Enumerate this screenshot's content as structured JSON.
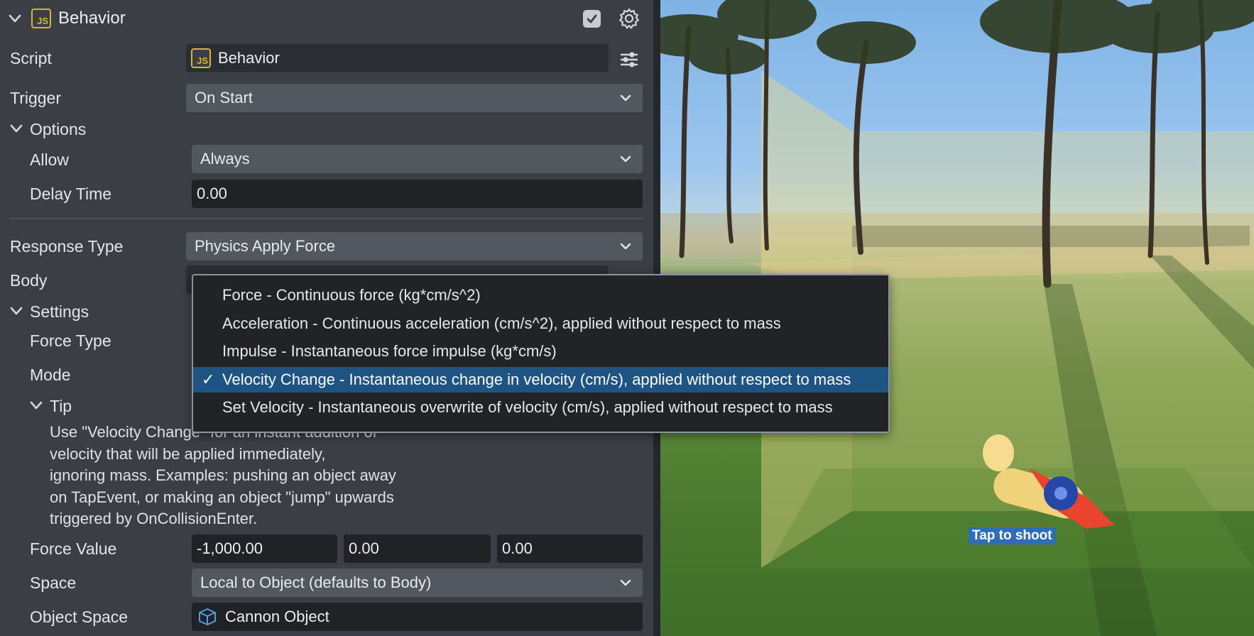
{
  "header": {
    "title": "Behavior",
    "enabled": true
  },
  "fields": {
    "script_label": "Script",
    "script_value": "Behavior",
    "trigger_label": "Trigger",
    "trigger_value": "On Start",
    "options_label": "Options",
    "allow_label": "Allow",
    "allow_value": "Always",
    "delay_label": "Delay Time",
    "delay_value": "0.00",
    "response_type_label": "Response Type",
    "response_type_value": "Physics Apply Force",
    "body_label": "Body",
    "settings_label": "Settings",
    "force_type_label": "Force Type",
    "mode_label": "Mode",
    "tip_label": "Tip",
    "tip_text": "Use \"Velocity Change\" for an instant addition of\nvelocity that will be applied immediately,\nignoring mass. Examples: pushing an object away\non TapEvent, or making an object \"jump\" upwards\ntriggered by OnCollisionEnter.",
    "force_value_label": "Force Value",
    "force_value": [
      "-1,000.00",
      "0.00",
      "0.00"
    ],
    "space_label": "Space",
    "space_value": "Local to Object (defaults to Body)",
    "object_space_label": "Object Space",
    "object_space_value": "Cannon Object"
  },
  "mode_menu": {
    "items": [
      "Force - Continuous force (kg*cm/s^2)",
      "Acceleration - Continuous acceleration (cm/s^2), applied without respect to mass",
      "Impulse - Instantaneous force impulse (kg*cm/s)",
      "Velocity Change - Instantaneous change in velocity (cm/s), applied without respect to mass",
      "Set Velocity - Instantaneous overwrite of velocity (cm/s), applied without respect to mass"
    ],
    "selected_index": 3,
    "check_glyph": "✓"
  },
  "preview": {
    "tap_label": "Tap to shoot"
  },
  "colors": {
    "accent": "#1e5484",
    "js_badge": "#d6b63a",
    "panel_bg": "#3b3f45"
  }
}
